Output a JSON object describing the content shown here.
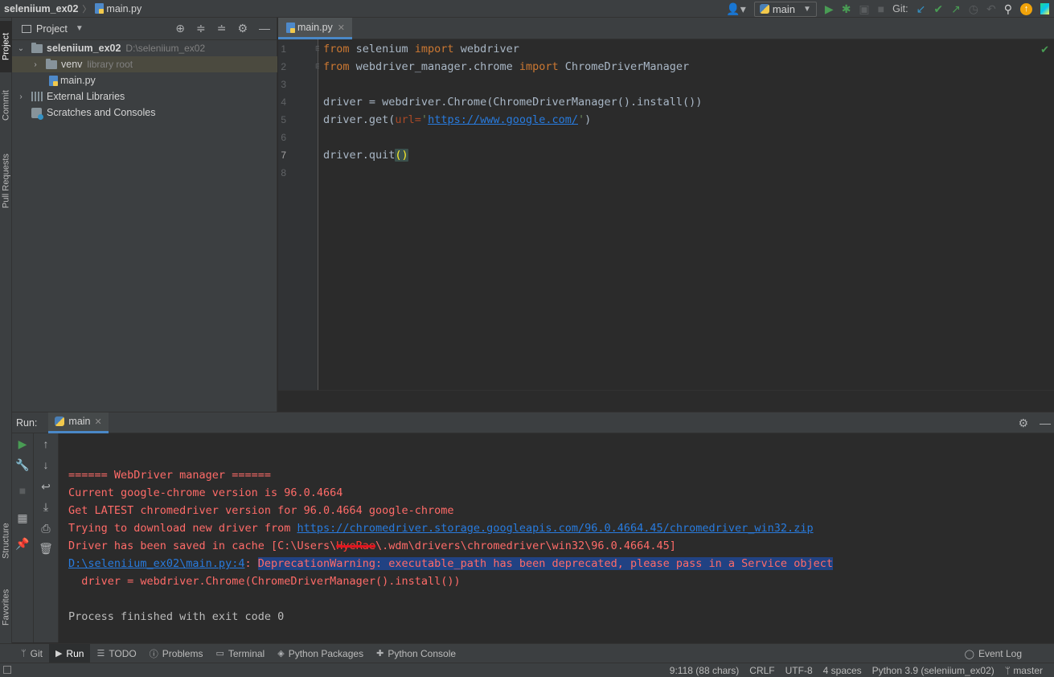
{
  "navbar": {
    "project": "seleniium_ex02",
    "file": "main.py",
    "run_config": "main",
    "git_label": "Git:"
  },
  "left_stripe": {
    "project": "Project",
    "commit": "Commit",
    "pull_requests": "Pull Requests",
    "structure": "Structure",
    "favorites": "Favorites"
  },
  "project_panel": {
    "title": "Project",
    "tree": {
      "root_name": "seleniium_ex02",
      "root_path": "D:\\seleniium_ex02",
      "venv_name": "venv",
      "venv_hint": "library root",
      "main_file": "main.py",
      "external_libs": "External Libraries",
      "scratches": "Scratches and Consoles"
    }
  },
  "editor": {
    "tab": "main.py",
    "line_numbers": [
      "1",
      "2",
      "3",
      "4",
      "5",
      "6",
      "7",
      "8"
    ],
    "code": {
      "l1_kw1": "from",
      "l1_mod": " selenium ",
      "l1_kw2": "import",
      "l1_name": " webdriver",
      "l2_kw1": "from",
      "l2_mod": " webdriver_manager.chrome ",
      "l2_kw2": "import",
      "l2_name": " ChromeDriverManager",
      "l4": "driver = webdriver.Chrome(ChromeDriverManager().install())",
      "l5_pre": "driver.get(",
      "l5_param": "url=",
      "l5_q1": "'",
      "l5_url": "https://www.google.com/",
      "l5_q2": "'",
      "l5_post": ")",
      "l7_pre": "driver.quit",
      "l7_parens": "()"
    }
  },
  "run_panel": {
    "label": "Run:",
    "tab": "main",
    "console": {
      "line1": "====== WebDriver manager ======",
      "line2": "Current google-chrome version is 96.0.4664",
      "line3": "Get LATEST chromedriver version for 96.0.4664 google-chrome",
      "line4_pre": "Trying to download new driver from ",
      "line4_link": "https://chromedriver.storage.googleapis.com/96.0.4664.45/chromedriver_win32.zip",
      "line5_pre": "Driver has been saved in cache [C:\\Users\\",
      "line5_redacted": "HyeRae",
      "line5_post": "\\.wdm\\drivers\\chromedriver\\win32\\96.0.4664.45]",
      "line6_link": "D:\\seleniium_ex02\\main.py:4",
      "line6_colon": ": ",
      "line6_warning": "DeprecationWarning: executable_path has been deprecated, please pass in a Service object",
      "line7": "  driver = webdriver.Chrome(ChromeDriverManager().install())",
      "line9": "Process finished with exit code 0"
    }
  },
  "toolwindows": {
    "git": "Git",
    "run": "Run",
    "todo": "TODO",
    "problems": "Problems",
    "terminal": "Terminal",
    "python_packages": "Python Packages",
    "python_console": "Python Console",
    "event_log": "Event Log"
  },
  "statusbar": {
    "position": "9:118 (88 chars)",
    "line_sep": "CRLF",
    "encoding": "UTF-8",
    "indent": "4 spaces",
    "interpreter": "Python 3.9 (seleniium_ex02)",
    "branch": "master"
  },
  "colors": {
    "keyword": "#cc7832",
    "string": "#6a8759",
    "error_output": "#ff6b68",
    "link": "#287bde",
    "accent": "#4a88c7"
  }
}
